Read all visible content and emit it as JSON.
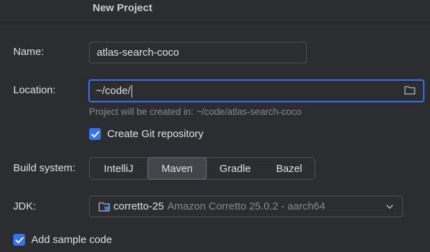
{
  "dialog": {
    "title": "New Project"
  },
  "form": {
    "name_label": "Name:",
    "name_value": "atlas-search-coco",
    "location_label": "Location:",
    "location_value": "~/code/",
    "location_hint": "Project will be created in: ~/code/atlas-search-coco",
    "git_checkbox_label": "Create Git repository",
    "git_checked": true,
    "build_label": "Build system:",
    "build_options": [
      "IntelliJ",
      "Maven",
      "Gradle",
      "Bazel"
    ],
    "build_selected": "Maven",
    "jdk_label": "JDK:",
    "jdk_name": "corretto-25",
    "jdk_detail": "Amazon Corretto 25.0.2 - aarch64",
    "sample_checkbox_label": "Add sample code",
    "sample_checked": true
  },
  "icons": {
    "folder": "folder-icon",
    "check": "checkmark-icon",
    "jdk": "jdk-folder-icon",
    "dropdown": "chevron-down-icon"
  },
  "colors": {
    "accent": "#3574f0",
    "background": "#2b2d30",
    "text": "#dfe1e5",
    "muted": "#868a91"
  }
}
